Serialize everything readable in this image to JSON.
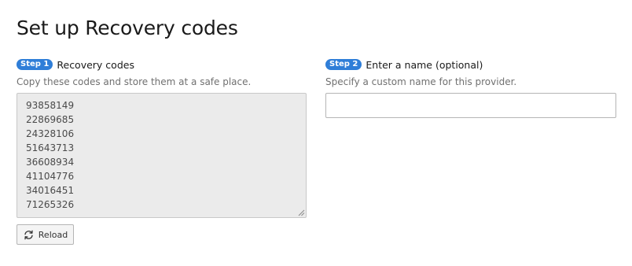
{
  "page": {
    "title": "Set up Recovery codes"
  },
  "step1": {
    "badge": "Step 1",
    "title": "Recovery codes",
    "description": "Copy these codes and store them at a safe place.",
    "codes": [
      "93858149",
      "22869685",
      "24328106",
      "51643713",
      "36608934",
      "41104776",
      "34016451",
      "71265326"
    ],
    "reload_label": "Reload",
    "reload_icon": "refresh-icon"
  },
  "step2": {
    "badge": "Step 2",
    "title": "Enter a name (optional)",
    "description": "Specify a custom name for this provider.",
    "name_value": "",
    "name_placeholder": ""
  },
  "colors": {
    "badge_background": "#2f7ed8",
    "codes_background": "#ebebeb",
    "description_text": "#707070"
  }
}
